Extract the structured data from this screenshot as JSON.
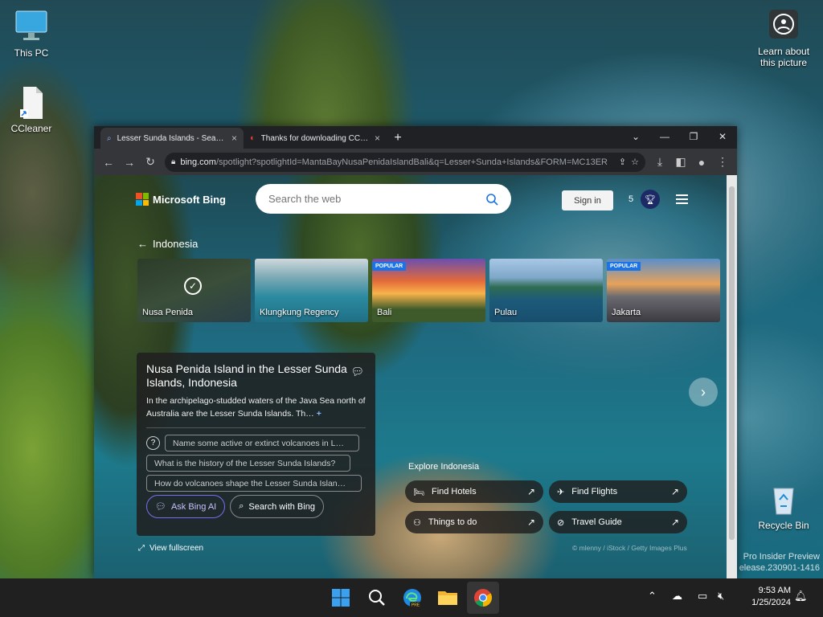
{
  "desktop": {
    "icons": {
      "this_pc": "This PC",
      "ccleaner": "CCleaner",
      "learn": "Learn about this picture",
      "recycle": "Recycle Bin"
    },
    "watermark_line1": "Pro Insider Preview",
    "watermark_line2": "elease.230901-1416"
  },
  "browser": {
    "tabs": [
      {
        "title": "Lesser Sunda Islands - Search",
        "active": true
      },
      {
        "title": "Thanks for downloading CCleaner",
        "active": false
      }
    ],
    "new_tab": "+",
    "url_domain": "bing.com",
    "url_rest": "/spotlight?spotlightId=MantaBayNusaPenidaIslandBali&q=Lesser+Sunda+Islands&FORM=MC13ER"
  },
  "bing": {
    "logo": "Microsoft Bing",
    "search_placeholder": "Search the web",
    "sign_in": "Sign in",
    "rewards": "5",
    "back_label": "Indonesia",
    "tiles": [
      {
        "label": "Nusa Penida",
        "popular": false,
        "selected": true
      },
      {
        "label": "Klungkung Regency",
        "popular": false,
        "selected": false
      },
      {
        "label": "Bali",
        "popular": true,
        "selected": false
      },
      {
        "label": "Pulau",
        "popular": false,
        "selected": false
      },
      {
        "label": "Jakarta",
        "popular": true,
        "selected": false
      }
    ],
    "popular_badge": "POPULAR",
    "card": {
      "title": "Nusa Penida Island in the Lesser Sunda Islands, Indonesia",
      "description": "In the archipelago-studded waters of the Java Sea north of Australia are the Lesser Sunda Islands. Th…",
      "questions": [
        "Name some active or extinct volcanoes in L…",
        "What is the history of the Lesser Sunda Islands?",
        "How do volcanoes shape the Lesser Sunda Islan…"
      ],
      "ask_ai": "Ask Bing AI",
      "search_with": "Search with Bing"
    },
    "view_fullscreen": "View fullscreen",
    "explore_title": "Explore Indonesia",
    "actions": [
      {
        "label": "Find Hotels"
      },
      {
        "label": "Find Flights"
      },
      {
        "label": "Things to do"
      },
      {
        "label": "Travel Guide"
      }
    ],
    "credit": "© mlenny / iStock / Getty Images Plus"
  },
  "taskbar": {
    "time": "9:53 AM",
    "date": "1/25/2024"
  }
}
